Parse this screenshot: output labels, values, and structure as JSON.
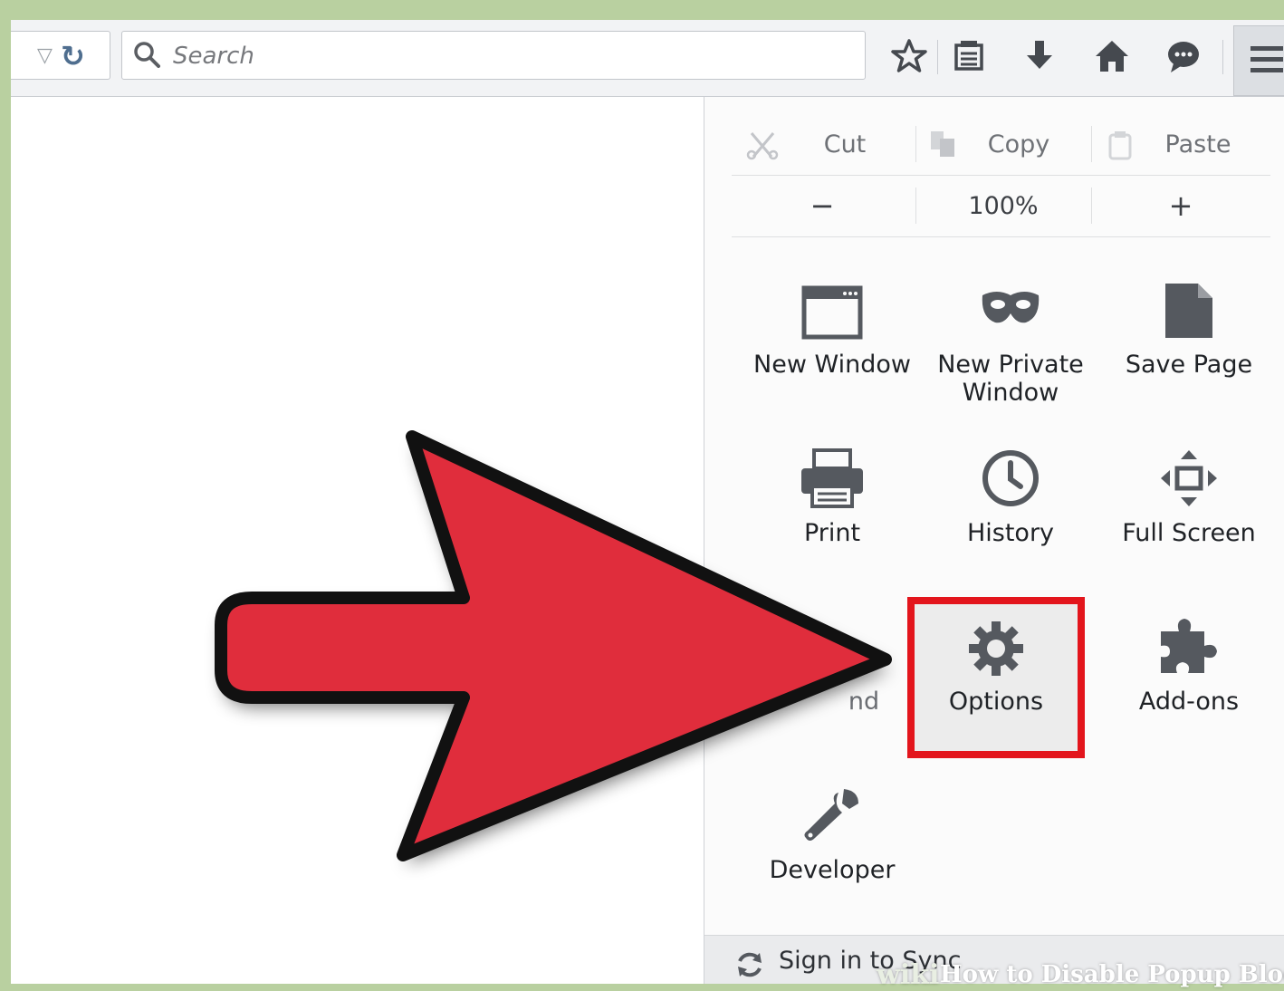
{
  "toolbar": {
    "search_placeholder": "Search",
    "icons": [
      "dropmarker-icon",
      "reload-icon",
      "bookmark-star-icon",
      "reading-list-icon",
      "download-icon",
      "home-icon",
      "chat-icon",
      "hamburger-menu-icon"
    ]
  },
  "menu_panel": {
    "edit": {
      "cut": "Cut",
      "copy": "Copy",
      "paste": "Paste"
    },
    "zoom": {
      "minus": "−",
      "level": "100%",
      "plus": "+"
    },
    "items": [
      {
        "label": "New Window",
        "icon": "window-icon"
      },
      {
        "label": "New Private Window",
        "icon": "mask-icon"
      },
      {
        "label": "Save Page",
        "icon": "page-icon"
      },
      {
        "label": "Print",
        "icon": "printer-icon"
      },
      {
        "label": "History",
        "icon": "clock-icon"
      },
      {
        "label": "Full Screen",
        "icon": "fullscreen-icon"
      },
      {
        "label": "Options",
        "icon": "gear-icon"
      },
      {
        "label": "Add-ons",
        "icon": "puzzle-icon"
      },
      {
        "label": "Developer",
        "icon": "wrench-icon"
      }
    ],
    "partial_hidden_label": "nd",
    "sign_in": "Sign in to Sync",
    "highlighted_item": "Options"
  },
  "overlay": {
    "arrow_color": "#e02d3c",
    "highlight_color": "#e3151c"
  },
  "watermark": {
    "wiki": "wiki",
    "title": "How to Disable Popup Block"
  }
}
